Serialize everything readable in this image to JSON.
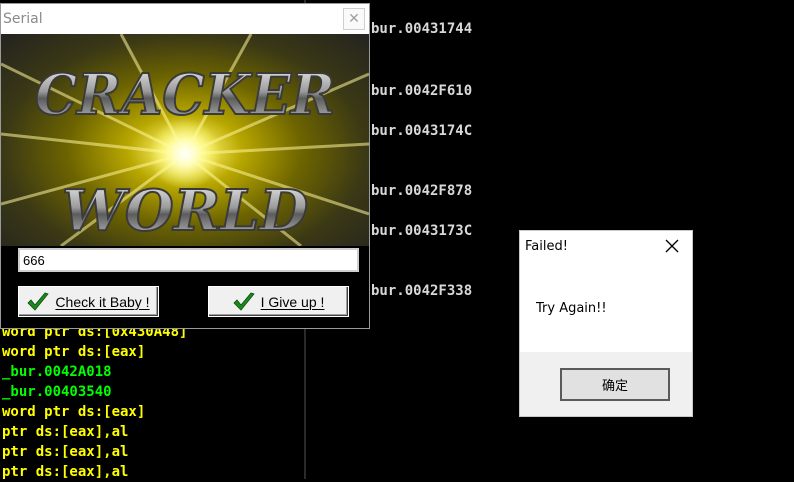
{
  "debugger": {
    "asm_lines": [
      {
        "text": "word ptr ds:[0x430A48]",
        "color": "#ffff00"
      },
      {
        "text": "word ptr ds:[eax]",
        "color": "#ffff00"
      },
      {
        "text": "_bur.0042A018",
        "color": "#00ff00"
      },
      {
        "text": "_bur.00403540",
        "color": "#00ff00"
      },
      {
        "text": "word ptr ds:[eax]",
        "color": "#ffff00"
      },
      {
        "text": "ptr ds:[eax],al",
        "color": "#ffff00"
      },
      {
        "text": "ptr ds:[eax],al",
        "color": "#ffff00"
      },
      {
        "text": "ptr ds:[eax],al",
        "color": "#ffff00"
      }
    ],
    "ref_lines": [
      "bur.00431744",
      "bur.0042F610",
      "bur.0043174C",
      "bur.0042F878",
      "bur.0043173C",
      "bur.0042F338"
    ]
  },
  "serial_window": {
    "title": "Serial",
    "close_glyph": "✕",
    "banner_text_1": "CRACKER",
    "banner_text_2": "WORLD",
    "serial_value": "666",
    "check_button": "Check it Baby !",
    "giveup_button": "I Give up !",
    "check_color": "#1a8a1a"
  },
  "failed_dialog": {
    "title": "Failed!",
    "message": "Try Again!!",
    "ok_button": "确定"
  }
}
